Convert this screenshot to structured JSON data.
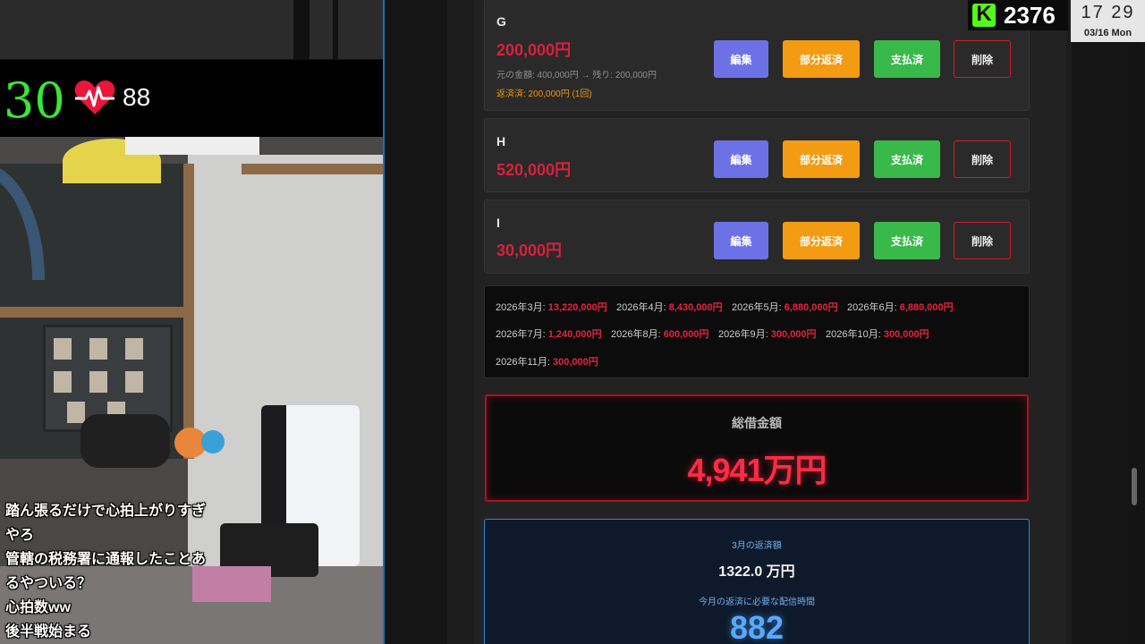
{
  "stream": {
    "speed": "30",
    "heart_rate": "88",
    "viewer_count": "2376",
    "clock": {
      "time": "17 29",
      "date": "03/16 Mon"
    }
  },
  "chat": {
    "messages": [
      "踏ん張るだけで心拍上がりすぎ",
      "やろ",
      "管轄の税務署に通報したことあ",
      "るやついる？",
      "心拍数ww",
      "後半戦始まる"
    ]
  },
  "app": {
    "buttons": {
      "edit": "編集",
      "partial": "部分返済",
      "paid": "支払済",
      "delete": "削除"
    },
    "debts": [
      {
        "name": "G",
        "amount": "200,000円",
        "original": "元の金額: 400,000円 → 残り: 200,000円",
        "paid": "返済済: 200,000円 (1回)"
      },
      {
        "name": "H",
        "amount": "520,000円"
      },
      {
        "name": "I",
        "amount": "30,000円"
      }
    ],
    "schedule": [
      {
        "month": "2026年3月:",
        "amount": "13,220,000円"
      },
      {
        "month": "2026年4月:",
        "amount": "8,430,000円"
      },
      {
        "month": "2026年5月:",
        "amount": "6,880,000円"
      },
      {
        "month": "2026年6月:",
        "amount": "6,880,000円"
      },
      {
        "month": "2026年7月:",
        "amount": "1,240,000円"
      },
      {
        "month": "2026年8月:",
        "amount": "600,000円"
      },
      {
        "month": "2026年9月:",
        "amount": "300,000円"
      },
      {
        "month": "2026年10月:",
        "amount": "300,000円"
      },
      {
        "month": "2026年11月:",
        "amount": "300,000円"
      }
    ],
    "total": {
      "label": "総借金額",
      "value": "4,941万円"
    },
    "repayment": {
      "month_label": "3月の返済額",
      "amount": "1322.0 万円",
      "hours_label": "今月の返済に必要な配信時間",
      "hours": "882"
    }
  },
  "colors": {
    "debt_red": "#d8213d",
    "accent_blue": "#2e86d6",
    "kick_green": "#53fc18",
    "speed_green": "#39e639"
  }
}
